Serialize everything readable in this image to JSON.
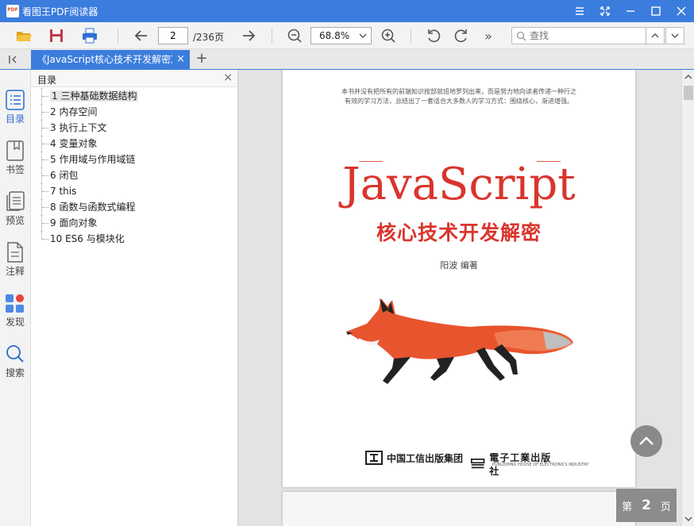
{
  "window": {
    "title": "看图王PDF阅读器",
    "controls": [
      "menu-icon",
      "restore-fullscreen-icon",
      "minimize-icon",
      "maximize-icon",
      "close-icon"
    ]
  },
  "toolbar": {
    "page_current": "2",
    "page_total": "/236页",
    "zoom": "68.8%",
    "search_placeholder": "查找",
    "more": "»"
  },
  "tabs": [
    {
      "title": "《JavaScript核心技术开发解密》",
      "close": "×"
    }
  ],
  "new_tab": "+",
  "rail": {
    "items": [
      {
        "label": "目录",
        "icon": "toc-icon"
      },
      {
        "label": "书签",
        "icon": "bookmark-icon"
      },
      {
        "label": "预览",
        "icon": "preview-icon"
      },
      {
        "label": "注释",
        "icon": "annotation-icon"
      },
      {
        "label": "发现",
        "icon": "discover-icon"
      },
      {
        "label": "搜索",
        "icon": "search-icon"
      }
    ]
  },
  "toc": {
    "title": "目录",
    "close": "×",
    "items": [
      "1 三种基础数据结构",
      "2 内存空间",
      "3 执行上下文",
      "4 变量对象",
      "5 作用域与作用域链",
      "6 闭包",
      "7 this",
      "8 函数与函数式编程",
      "9 面向对象",
      "10 ES6 与模块化"
    ]
  },
  "cover": {
    "intro_line1": "本书并没有把所有的前端知识按部就班地罗列出来，而是努力地向读者传递一种行之",
    "intro_line2": "有效的学习方法，总结出了一套适合大多数人的学习方式：围绕核心，渐进增强。",
    "title": "JavaScript",
    "subtitle": "核心技术开发解密",
    "author": "阳波  编著",
    "publisher1": "中国工信出版集团",
    "publisher2": "電子工業出版社",
    "publisher2_sub": "PUBLISHING HOUSE OF ELECTRONICS INDUSTRY"
  },
  "page_badge": {
    "prefix": "第",
    "number": "2",
    "suffix": "页"
  },
  "colors": {
    "accent": "#3b7ddd",
    "cover_red": "#d9352d",
    "fox_orange": "#e8542e"
  }
}
